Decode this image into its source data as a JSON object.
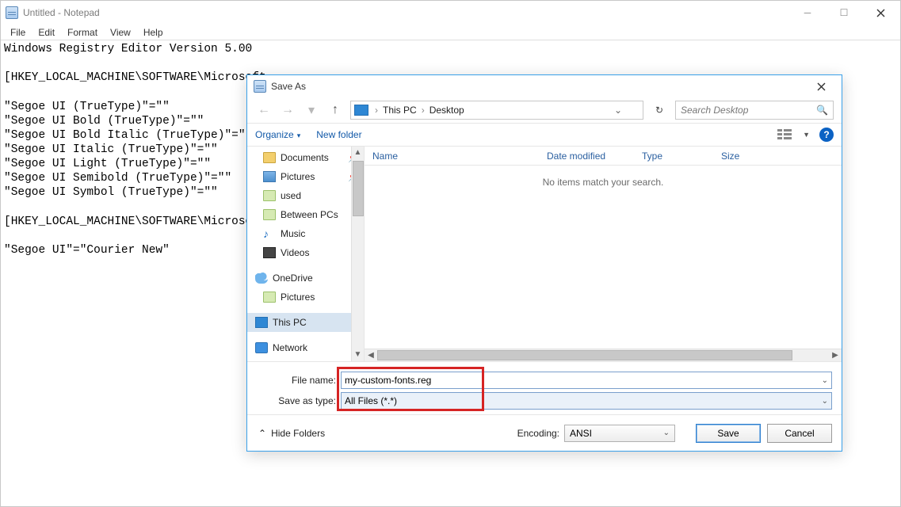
{
  "notepad": {
    "title": "Untitled - Notepad",
    "menus": {
      "file": "File",
      "edit": "Edit",
      "format": "Format",
      "view": "View",
      "help": "Help"
    },
    "content": "Windows Registry Editor Version 5.00\n\n[HKEY_LOCAL_MACHINE\\SOFTWARE\\Microsoft\n\n\"Segoe UI (TrueType)\"=\"\"\n\"Segoe UI Bold (TrueType)\"=\"\"\n\"Segoe UI Bold Italic (TrueType)\"=\"\"\n\"Segoe UI Italic (TrueType)\"=\"\"\n\"Segoe UI Light (TrueType)\"=\"\"\n\"Segoe UI Semibold (TrueType)\"=\"\"\n\"Segoe UI Symbol (TrueType)\"=\"\"\n\n[HKEY_LOCAL_MACHINE\\SOFTWARE\\Microsof\n\n\"Segoe UI\"=\"Courier New\""
  },
  "dialog": {
    "title": "Save As",
    "breadcrumb": {
      "root": "This PC",
      "folder": "Desktop"
    },
    "search_placeholder": "Search Desktop",
    "toolbar": {
      "organize": "Organize",
      "newfolder": "New folder"
    },
    "tree": {
      "items": [
        {
          "label": "Documents",
          "icon": "folder",
          "pinned": true
        },
        {
          "label": "Pictures",
          "icon": "pics",
          "pinned": true
        },
        {
          "label": "used",
          "icon": "folder-green",
          "pinned": false
        },
        {
          "label": "Between PCs",
          "icon": "folder-green",
          "pinned": false
        },
        {
          "label": "Music",
          "icon": "music",
          "pinned": false
        },
        {
          "label": "Videos",
          "icon": "video",
          "pinned": false
        }
      ],
      "groups": {
        "onedrive": "OneDrive",
        "onedrive_child": "Pictures",
        "thispc": "This PC",
        "network": "Network"
      }
    },
    "columns": {
      "name": "Name",
      "date": "Date modified",
      "type": "Type",
      "size": "Size"
    },
    "empty": "No items match your search.",
    "filename_label": "File name:",
    "filename_value": "my-custom-fonts.reg",
    "saveastype_label": "Save as type:",
    "saveastype_value": "All Files  (*.*)",
    "hide_folders": "Hide Folders",
    "encoding_label": "Encoding:",
    "encoding_value": "ANSI",
    "save": "Save",
    "cancel": "Cancel"
  }
}
